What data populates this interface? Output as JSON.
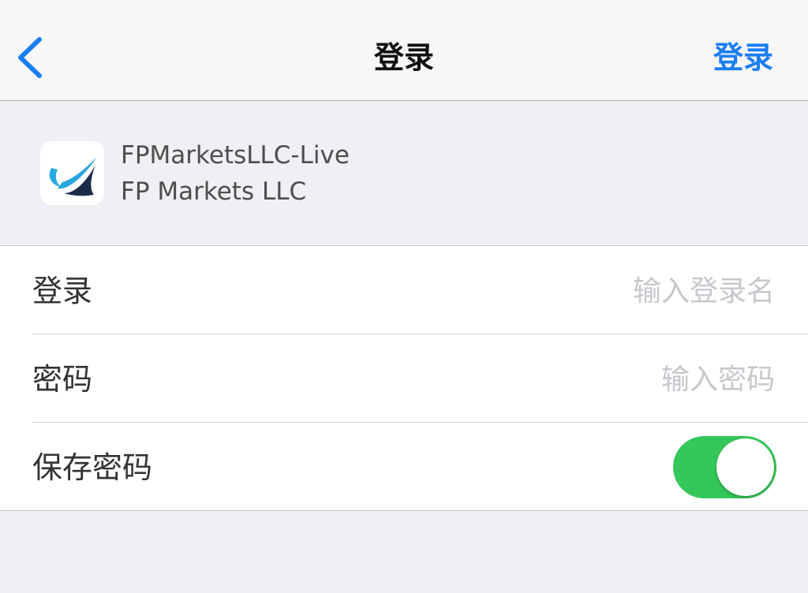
{
  "navbar": {
    "title": "登录",
    "action_label": "登录",
    "accent_color": "#1a7ef3"
  },
  "server": {
    "name": "FPMarketsLLC-Live",
    "company": "FP Markets LLC",
    "logo_icon": "fp-markets-logo"
  },
  "form": {
    "login": {
      "label": "登录",
      "value": "",
      "placeholder": "输入登录名"
    },
    "password": {
      "label": "密码",
      "value": "",
      "placeholder": "输入密码"
    },
    "save_password": {
      "label": "保存密码",
      "enabled": true,
      "color": "#34c759"
    }
  }
}
